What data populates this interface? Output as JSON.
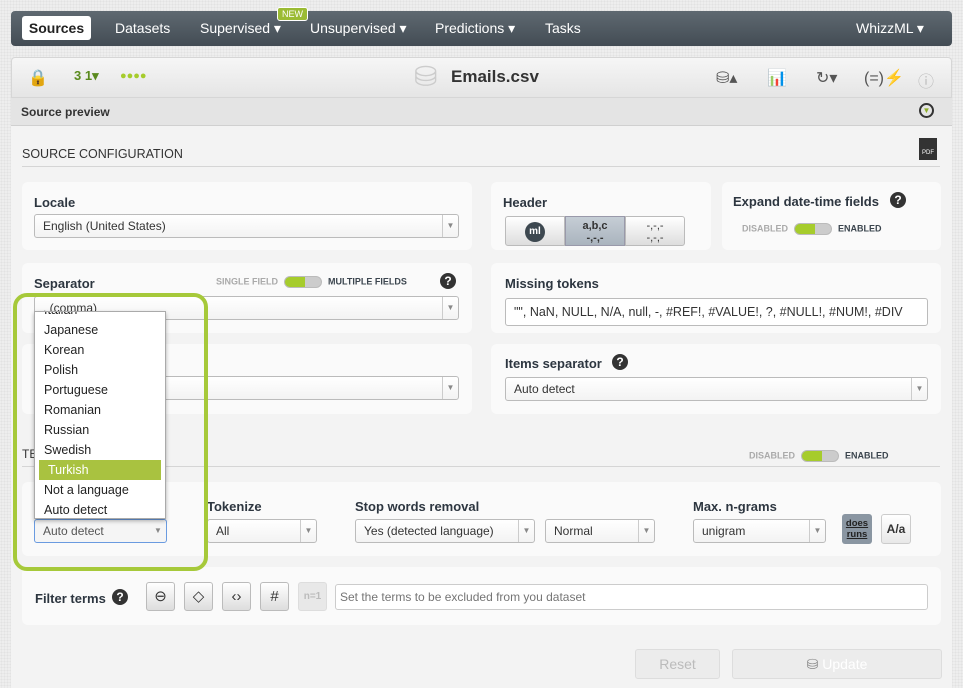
{
  "nav": {
    "items": [
      "Sources",
      "Datasets",
      "Supervised ▾",
      "Unsupervised ▾",
      "Predictions ▾",
      "Tasks"
    ],
    "new_badge": "NEW",
    "user_menu": "WhizzML ▾"
  },
  "toolbar": {
    "title": "Emails.csv"
  },
  "preview": {
    "label": "Source preview"
  },
  "config": {
    "section_title": "SOURCE CONFIGURATION",
    "pdf": "PDF",
    "locale": {
      "label": "Locale",
      "value": "English (United States)"
    },
    "header": {
      "label": "Header",
      "opt_ml": "ml",
      "opt_abc": "a,b,c",
      "opt_sub": "-,-,-",
      "opt_none": "-,-,-"
    },
    "expand": {
      "label": "Expand date-time fields",
      "off": "DISABLED",
      "on": "ENABLED"
    },
    "separator": {
      "label": "Separator",
      "off": "SINGLE FIELD",
      "on": "MULTIPLE FIELDS",
      "value": ", (comma)"
    },
    "missing": {
      "label": "Missing tokens",
      "value": "\"\", NaN, NULL, N/A, null, -, #REF!, #VALUE!, ?, #NULL!, #NUM!, #DIV"
    },
    "items_sep": {
      "label": "Items separator",
      "value": "Auto detect"
    }
  },
  "text": {
    "section_title": "TE",
    "off": "DISABLED",
    "on": "ENABLED",
    "language_value": "Auto detect",
    "language_options": [
      "Italian",
      "Japanese",
      "Korean",
      "Polish",
      "Portuguese",
      "Romanian",
      "Russian",
      "Swedish",
      "Turkish",
      "Not a language",
      "Auto detect"
    ],
    "language_selected": "Turkish",
    "tokenize": {
      "label": "Tokenize",
      "value": "All"
    },
    "stop": {
      "label": "Stop words removal",
      "value": "Yes (detected language)",
      "level": "Normal"
    },
    "ngrams": {
      "label": "Max. n-grams",
      "value": "unigram"
    },
    "stem_btn": "does runs",
    "case_btn": "A/a",
    "filter": {
      "label": "Filter terms",
      "n1": "n=1",
      "placeholder": "Set the terms to be excluded from you dataset"
    }
  },
  "actions": {
    "reset": "Reset",
    "update": "Update"
  },
  "colors": {
    "accent": "#a6c93a",
    "nav": "#4a545c"
  }
}
